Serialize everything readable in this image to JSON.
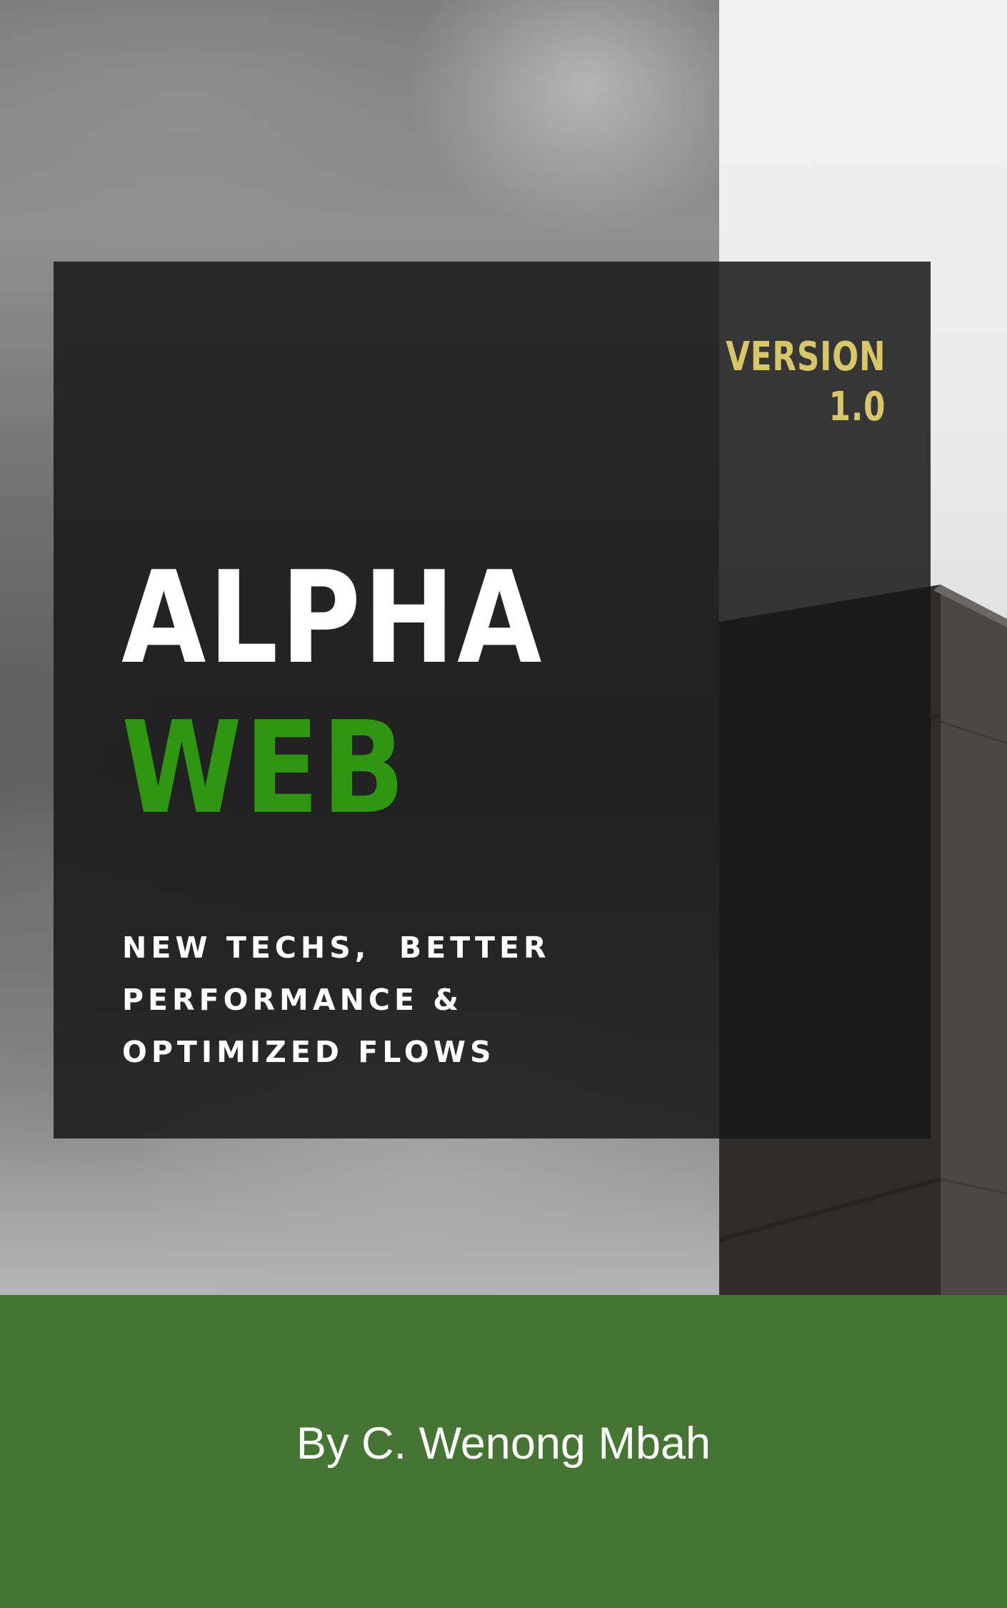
{
  "cover": {
    "version_line1": "VERSION",
    "version_line2": "1.0",
    "title_line1": "ALPHA",
    "title_line2": "WEB",
    "tagline": [
      "NEW TECHS,  BETTER",
      "PERFORMANCE &",
      "OPTIMIZED FLOWS"
    ],
    "author": "By C. Wenong Mbah"
  },
  "colors": {
    "panel": "#181818",
    "version_text": "#d7c66a",
    "title_primary": "#ffffff",
    "title_accent": "#2e9612",
    "footer": "#467533",
    "footer_text": "#ffffff"
  }
}
